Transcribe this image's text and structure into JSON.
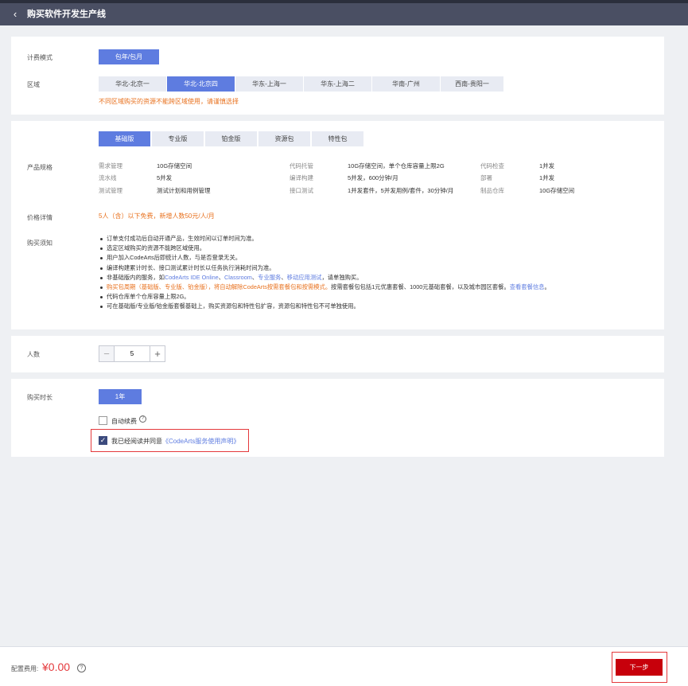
{
  "header": {
    "title": "购买软件开发生产线"
  },
  "billing": {
    "label": "计费模式",
    "option": "包年/包月"
  },
  "region": {
    "label": "区域",
    "items": [
      "华北-北京一",
      "华北-北京四",
      "华东-上海一",
      "华东-上海二",
      "华南-广州",
      "西南-贵阳一"
    ],
    "selected": "华北-北京四",
    "warning": "不同区域购买的资源不能跨区域使用，请谨慎选择"
  },
  "editions": {
    "tabs": [
      "基础版",
      "专业版",
      "铂金版",
      "资源包",
      "特性包"
    ],
    "selected": "基础版"
  },
  "spec": {
    "label": "产品规格",
    "rows": [
      [
        {
          "k": "需求管理",
          "v": "10G存储空间"
        },
        {
          "k": "代码托管",
          "v": "10G存储空间，单个仓库容量上限2G"
        },
        {
          "k": "代码检查",
          "v": "1并发"
        }
      ],
      [
        {
          "k": "流水线",
          "v": "5并发"
        },
        {
          "k": "编译构建",
          "v": "5并发，600分钟/月"
        },
        {
          "k": "部署",
          "v": "1并发"
        }
      ],
      [
        {
          "k": "测试管理",
          "v": "测试计划和用例管理"
        },
        {
          "k": "接口测试",
          "v": "1并发套件，5并发用例/套件，30分钟/月"
        },
        {
          "k": "制品仓库",
          "v": "10G存储空间"
        }
      ]
    ]
  },
  "price": {
    "label": "价格详情",
    "text": "5人（含）以下免费，新增人数50元/人/月"
  },
  "notice": {
    "label": "购买须知",
    "items": {
      "n1": "订单支付成功后自动开通产品，生效时间以订单时间为准。",
      "n2": "选定区域购买的资源不能跨区域使用。",
      "n3": "用户加入CodeArts后即统计人数，与是否登录无关。",
      "n4": "编译构建累计时长、接口测试累计时长以任务执行消耗时间为准。",
      "n5a": "非基础版内的服务，如",
      "n5b": "CodeArts IDE Online",
      "n5c": "、",
      "n5d": "Classroom",
      "n5e": "、",
      "n5f": "专业服务",
      "n5g": "、",
      "n5h": "移动应用测试",
      "n5i": "，请单独购买。",
      "n6a": "购买包周期（基础版、专业版、铂金版），将自动解除CodeArts按需套餐包和按需模式。",
      "n6b": "按需套餐包包括1元优惠套餐、1000元基础套餐，以及城市园区套餐。",
      "n6c": "查看套餐信息",
      "n6d": "。",
      "n7": "代码仓库单个仓库容量上限2G。",
      "n8": "可在基础版/专业版/铂金版套餐基础上，购买资源包和特性包扩容，资源包和特性包不可单独使用。"
    }
  },
  "users": {
    "label": "人数",
    "value": "5",
    "minus": "−",
    "plus": "+"
  },
  "duration": {
    "label": "购买时长",
    "option": "1年",
    "auto_renew": "自动续费",
    "help": "?",
    "agree_prefix": "我已经阅读并同意",
    "agree_link": "《CodeArts服务使用声明》"
  },
  "footer": {
    "fee_label": "配置费用:",
    "fee_value": "¥0.00",
    "help": "?",
    "next": "下一步"
  },
  "colors": {
    "accent": "#5e7ce0",
    "warning": "#e8711e",
    "price": "#e4393c",
    "next": "#c7000b"
  },
  "icons": {
    "back": "chevron-left-icon",
    "check": "check-icon",
    "help": "question-circle-icon"
  }
}
